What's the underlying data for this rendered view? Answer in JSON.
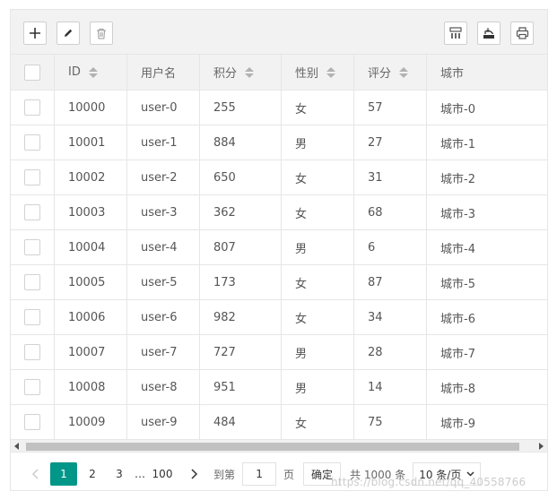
{
  "toolbar": {
    "left_icons": [
      "plus-icon",
      "pencil-icon",
      "trash-icon"
    ],
    "right_icons": [
      "columns-filter-icon",
      "export-icon",
      "print-icon"
    ]
  },
  "table": {
    "columns": [
      {
        "label": "",
        "sortable": false
      },
      {
        "label": "ID",
        "sortable": true
      },
      {
        "label": "用户名",
        "sortable": false
      },
      {
        "label": "积分",
        "sortable": true
      },
      {
        "label": "性别",
        "sortable": true
      },
      {
        "label": "评分",
        "sortable": true
      },
      {
        "label": "城市",
        "sortable": false
      }
    ],
    "rows": [
      [
        "10000",
        "user-0",
        "255",
        "女",
        "57",
        "城市-0"
      ],
      [
        "10001",
        "user-1",
        "884",
        "男",
        "27",
        "城市-1"
      ],
      [
        "10002",
        "user-2",
        "650",
        "女",
        "31",
        "城市-2"
      ],
      [
        "10003",
        "user-3",
        "362",
        "女",
        "68",
        "城市-3"
      ],
      [
        "10004",
        "user-4",
        "807",
        "男",
        "6",
        "城市-4"
      ],
      [
        "10005",
        "user-5",
        "173",
        "女",
        "87",
        "城市-5"
      ],
      [
        "10006",
        "user-6",
        "982",
        "女",
        "34",
        "城市-6"
      ],
      [
        "10007",
        "user-7",
        "727",
        "男",
        "28",
        "城市-7"
      ],
      [
        "10008",
        "user-8",
        "951",
        "男",
        "14",
        "城市-8"
      ],
      [
        "10009",
        "user-9",
        "484",
        "女",
        "75",
        "城市-9"
      ]
    ]
  },
  "pager": {
    "pages": [
      "1",
      "2",
      "3"
    ],
    "ellipsis": "…",
    "last": "100",
    "goto_label": "到第",
    "goto_value": "1",
    "page_unit": "页",
    "confirm": "确定",
    "total": "共 1000 条",
    "page_size": "10 条/页"
  },
  "watermark": "https://blog.csdn.net/qq_40558766",
  "colors": {
    "accent": "#009688",
    "header_bg": "#f2f2f2",
    "border": "#e6e6e6"
  }
}
